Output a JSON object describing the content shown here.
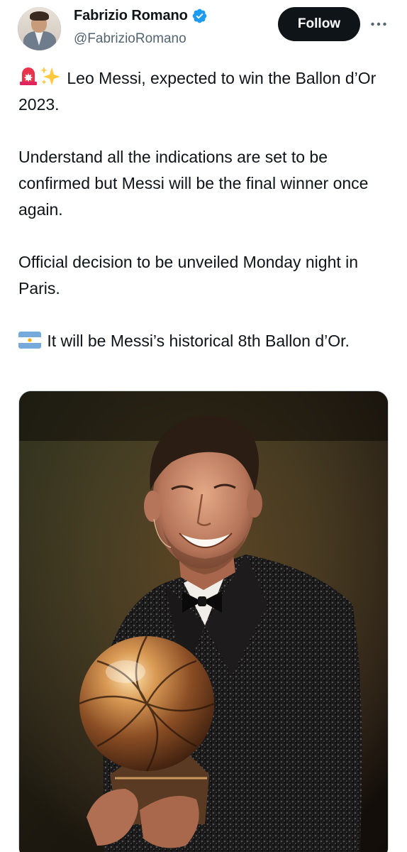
{
  "author": {
    "display_name": "Fabrizio Romano",
    "handle": "@FabrizioRomano",
    "verified": true,
    "avatar_icon": "profile-photo"
  },
  "actions": {
    "follow_label": "Follow",
    "more_icon": "more-horizontal-icon"
  },
  "tweet": {
    "paragraph_1": "Leo Messi, expected to win the Ballon d’Or 2023.",
    "paragraph_2": "Understand all the indications are set to be confirmed but Messi will be the final winner once again.",
    "paragraph_3": "Official decision to be unveiled Monday night in Paris.",
    "paragraph_4": "It will be Messi’s historical 8th Ballon d’Or.",
    "emoji_1": "rotating-light-emoji",
    "emoji_2": "sparkles-emoji",
    "emoji_3": "argentina-flag-emoji"
  },
  "media": {
    "type": "photo",
    "subject": "messi-holding-ballon-dor"
  },
  "colors": {
    "text_primary": "#0f1419",
    "text_secondary": "#536471",
    "verified_blue": "#1d9bf0",
    "follow_bg": "#0f1419"
  }
}
